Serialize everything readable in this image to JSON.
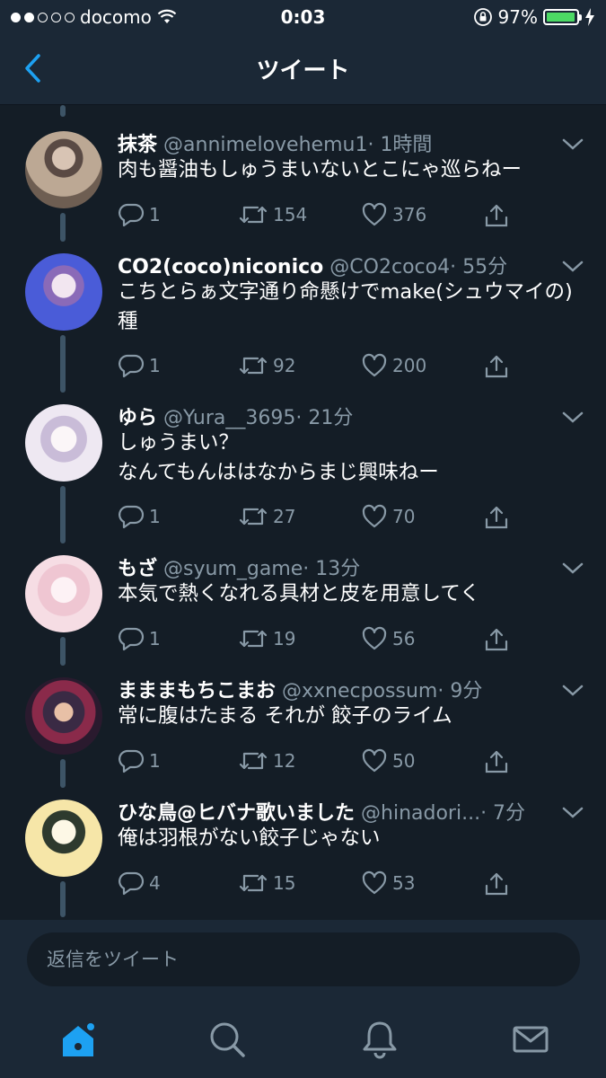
{
  "status": {
    "carrier": "docomo",
    "time": "0:03",
    "battery": "97%",
    "battery_level": 0.97
  },
  "nav": {
    "title": "ツイート"
  },
  "tweets": [
    {
      "name": "抹茶",
      "handle": "@annimelovehemu1",
      "time": "· 1時間",
      "text": "肉も醤油もしゅうまいないとこにゃ巡らねー",
      "replies": "1",
      "retweets": "154",
      "likes": "376"
    },
    {
      "name": "CO2(coco)niconico",
      "handle": "@CO2coco4",
      "time": "· 55分",
      "text": "こちとらぁ文字通り命懸けでmake(シュウマイの)種",
      "replies": "1",
      "retweets": "92",
      "likes": "200"
    },
    {
      "name": "ゆら",
      "handle": "@Yura__3695",
      "time": "· 21分",
      "text": "しゅうまい？\nなんてもんははなからまじ興味ねー",
      "replies": "1",
      "retweets": "27",
      "likes": "70"
    },
    {
      "name": "もざ",
      "handle": "@syum_game",
      "time": "· 13分",
      "text": "本気で熱くなれる具材と皮を用意してく",
      "replies": "1",
      "retweets": "19",
      "likes": "56"
    },
    {
      "name": "まままもちこまお",
      "handle": "@xxnecpossum",
      "time": "· 9分",
      "text": "常に腹はたまる それが 餃子のライム",
      "replies": "1",
      "retweets": "12",
      "likes": "50"
    },
    {
      "name": "ひな鳥@ヒバナ歌いました",
      "handle": "@hinadori...",
      "time": "· 7分",
      "text": "俺は羽根がない餃子じゃない",
      "replies": "4",
      "retweets": "15",
      "likes": "53"
    }
  ],
  "reply": {
    "placeholder": "返信をツイート"
  },
  "colors": {
    "accent": "#1da1f2",
    "background": "#141d26",
    "bar": "#1b2836",
    "muted": "#8899a6",
    "battery": "#4cd964"
  },
  "icons": [
    "back-chevron-icon",
    "reply-icon",
    "retweet-icon",
    "like-icon",
    "share-icon",
    "home-icon",
    "search-icon",
    "bell-icon",
    "mail-icon"
  ]
}
